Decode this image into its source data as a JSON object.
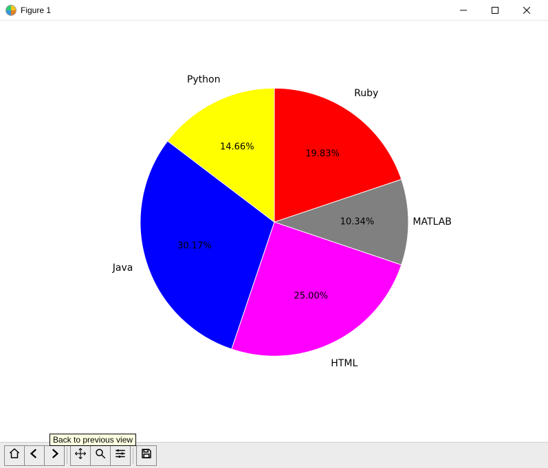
{
  "window": {
    "title": "Figure 1"
  },
  "chart_data": {
    "type": "pie",
    "title": "",
    "slices": [
      {
        "label": "Ruby",
        "pct": 19.83,
        "color": "#ff0000"
      },
      {
        "label": "MATLAB",
        "pct": 10.34,
        "color": "#808080"
      },
      {
        "label": "HTML",
        "pct": 25.0,
        "color": "#ff00ff"
      },
      {
        "label": "Java",
        "pct": 30.17,
        "color": "#0000ff"
      },
      {
        "label": "Python",
        "pct": 14.66,
        "color": "#ffff00"
      }
    ],
    "start_angle_deg": 90,
    "direction": "clockwise",
    "pct_format": "{:.2f}%"
  },
  "toolbar": {
    "home": "Home",
    "back": "Back",
    "forward": "Forward",
    "pan": "Pan",
    "zoom": "Zoom",
    "subplots": "Configure subplots",
    "save": "Save",
    "tooltip_back": "Back to previous view"
  }
}
